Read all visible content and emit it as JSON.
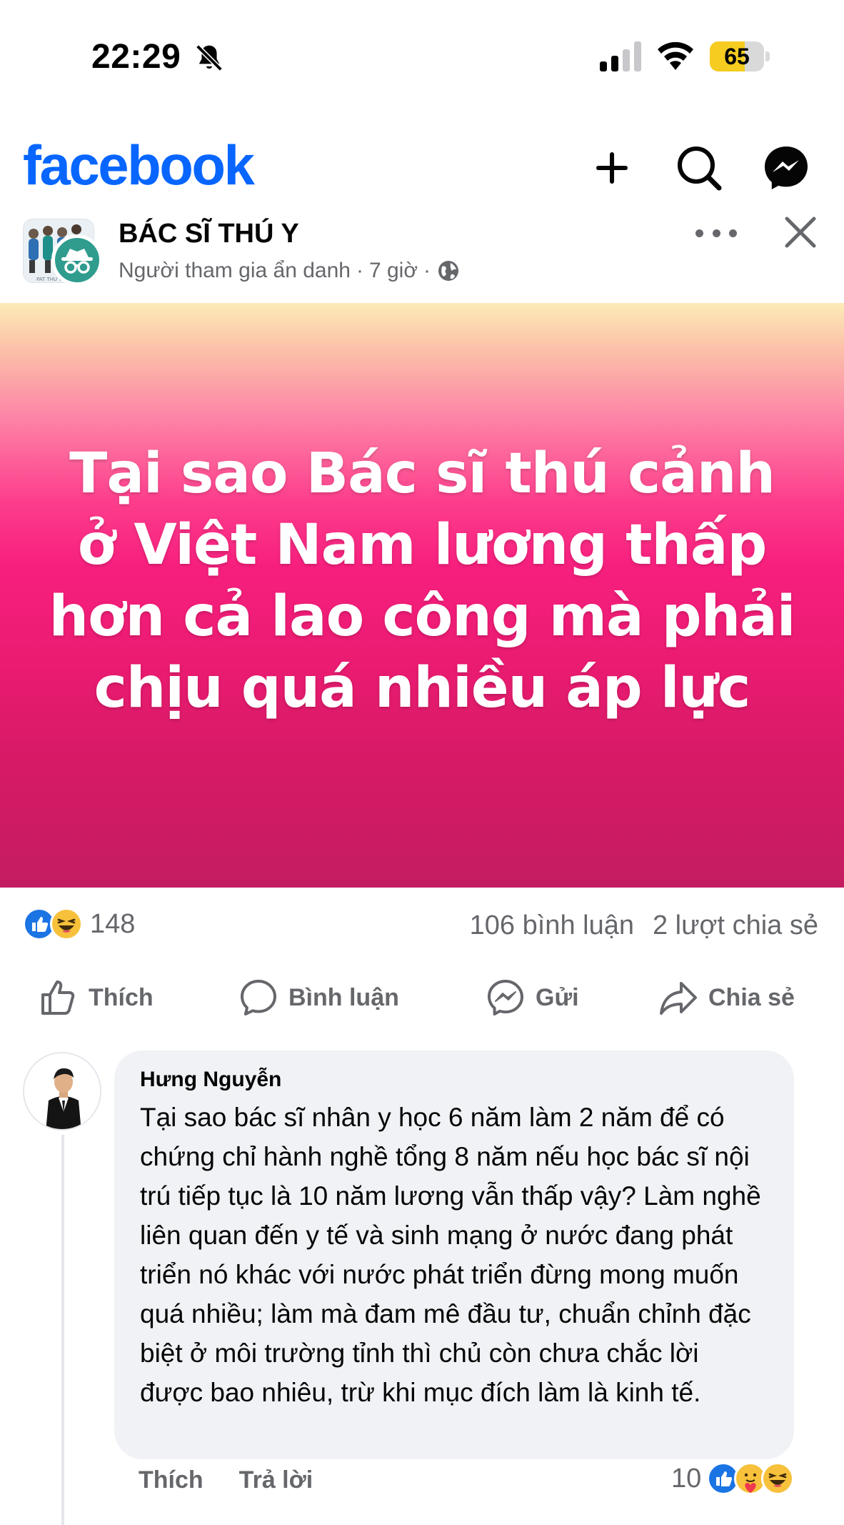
{
  "status_bar": {
    "time": "22:29",
    "battery": "65",
    "battery_level": 0.65
  },
  "header": {
    "logo": "facebook",
    "icons": [
      "plus-icon",
      "search-icon",
      "messenger-icon"
    ]
  },
  "post": {
    "group_name": "BÁC SĨ THÚ Y",
    "author_label": "Người tham gia ẩn danh",
    "time": "7 giờ",
    "separator": "·",
    "banner_text": "Tại sao Bác sĩ thú cảnh ở Việt Nam lương thấp hơn cả lao công mà phải chịu quá nhiều áp lực",
    "reaction_count": "148",
    "comments": "106 bình luận",
    "shares": "2 lượt chia sẻ",
    "colors": {
      "banner_top": "#fcebb6",
      "banner_mid": "#f71f7e",
      "banner_bottom": "#c41c61",
      "brand": "#0866ff"
    }
  },
  "actions": {
    "like": "Thích",
    "comment": "Bình luận",
    "send": "Gửi",
    "share": "Chia sẻ"
  },
  "comment": {
    "author": "Hưng Nguyễn",
    "text": "Tại sao bác sĩ nhân y học 6 năm làm 2 năm để có chứng chỉ hành nghề tổng 8 năm nếu học bác sĩ nội trú tiếp tục là 10 năm lương vẫn thấp vậy? Làm nghề liên quan đến y tế và sinh mạng ở nước đang phát triển nó khác với nước phát triển đừng mong muốn quá nhiều; làm mà đam mê đầu tư, chuẩn chỉnh đặc biệt ở môi trường tỉnh thì chủ còn chưa chắc lời được bao nhiêu, trừ khi mục đích làm là kinh tế.",
    "like_label": "Thích",
    "reply_label": "Trả lời",
    "reaction_count": "10"
  }
}
